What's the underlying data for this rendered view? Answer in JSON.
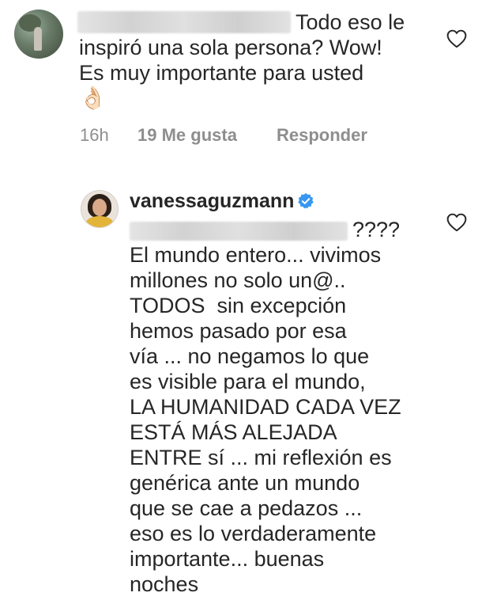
{
  "comments": [
    {
      "text_first_line": "Todo eso le",
      "text_rest": "inspiró una sola persona? Wow!\nEs muy importante para usted",
      "emoji": "👌🏻",
      "time": "16h",
      "likes": "19 Me gusta",
      "reply_label": "Responder"
    },
    {
      "username": "vanessaguzmann",
      "mention_suffix": "????",
      "text": "El mundo entero... vivimos\nmillones no solo un@..\nTODOS  sin excepción\nhemos pasado por esa\nvía ... no negamos lo que\nes visible para el mundo,\nLA HUMANIDAD CADA VEZ\nESTÁ MÁS ALEJADA\nENTRE sí ... mi reflexión es\ngenérica ante un mundo\nque se cae a pedazos ...\neso es lo verdaderamente\nimportante... buenas\nnoches"
    }
  ],
  "icons": {
    "like": "heart-outline-icon",
    "verified": "verified-badge-icon"
  },
  "colors": {
    "text": "#262626",
    "meta": "#8e8e8e",
    "verified": "#3897f0"
  }
}
